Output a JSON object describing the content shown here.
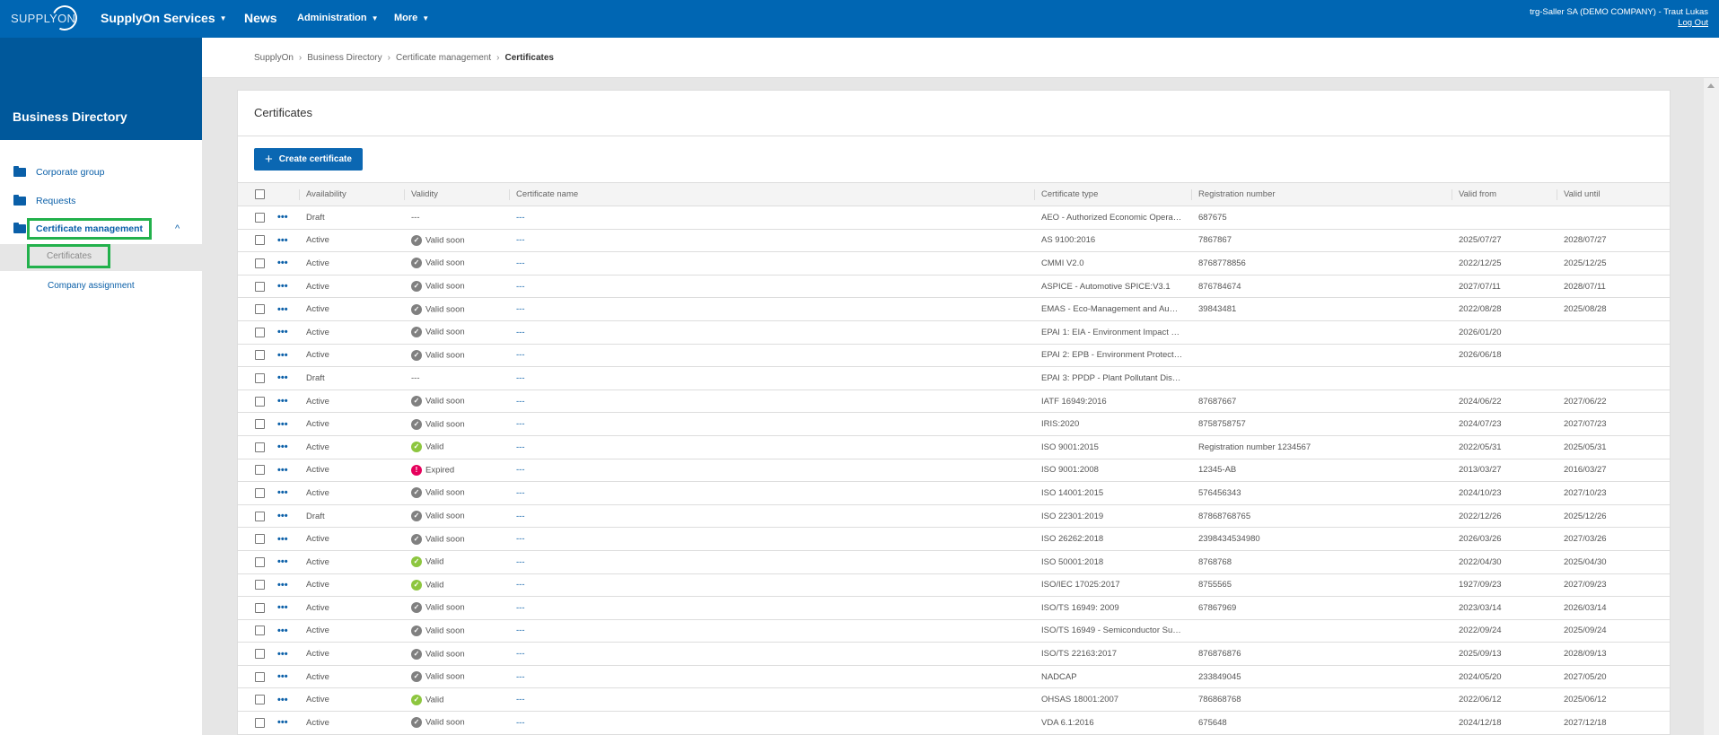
{
  "topbar": {
    "logo": "SUPPLYON",
    "services": "SupplyOn Services",
    "news": "News",
    "administration": "Administration",
    "more": "More",
    "user": "trg-Saller SA (DEMO COMPANY) - Traut Lukas",
    "logout": "Log Out",
    "caret": "▼"
  },
  "sidebar": {
    "title": "Business Directory",
    "items": [
      {
        "label": "Corporate group"
      },
      {
        "label": "Requests"
      },
      {
        "label": "Certificate management"
      }
    ],
    "chevron": "^",
    "sub_items": [
      {
        "label": "Certificates"
      },
      {
        "label": "Company assignment"
      }
    ]
  },
  "breadcrumb": {
    "items": [
      "SupplyOn",
      "Business Directory",
      "Certificate management"
    ],
    "current": "Certificates",
    "sep": "›"
  },
  "card": {
    "title": "Certificates",
    "create_button": "Create certificate",
    "plus": "+"
  },
  "table": {
    "columns": [
      "Availability",
      "Validity",
      "Certificate name",
      "Certificate type",
      "Registration number",
      "Valid from",
      "Valid until"
    ],
    "rows": [
      {
        "availability": "Draft",
        "validity": "---",
        "status": "none",
        "name": "---",
        "type": "AEO - Authorized Economic Opera…",
        "reg": "687675",
        "from": "",
        "until": ""
      },
      {
        "availability": "Active",
        "validity": "Valid soon",
        "status": "soon",
        "name": "---",
        "type": "AS 9100:2016",
        "reg": "7867867",
        "from": "2025/07/27",
        "until": "2028/07/27"
      },
      {
        "availability": "Active",
        "validity": "Valid soon",
        "status": "soon",
        "name": "---",
        "type": "CMMI V2.0",
        "reg": "8768778856",
        "from": "2022/12/25",
        "until": "2025/12/25"
      },
      {
        "availability": "Active",
        "validity": "Valid soon",
        "status": "soon",
        "name": "---",
        "type": "ASPICE - Automotive SPICE:V3.1",
        "reg": "876784674",
        "from": "2027/07/11",
        "until": "2028/07/11"
      },
      {
        "availability": "Active",
        "validity": "Valid soon",
        "status": "soon",
        "name": "---",
        "type": "EMAS - Eco-Management and Au…",
        "reg": "39843481",
        "from": "2022/08/28",
        "until": "2025/08/28"
      },
      {
        "availability": "Active",
        "validity": "Valid soon",
        "status": "soon",
        "name": "---",
        "type": "EPAI 1: EIA - Environment Impact …",
        "reg": "",
        "from": "2026/01/20",
        "until": ""
      },
      {
        "availability": "Active",
        "validity": "Valid soon",
        "status": "soon",
        "name": "---",
        "type": "EPAI 2: EPB - Environment Protect…",
        "reg": "",
        "from": "2026/06/18",
        "until": ""
      },
      {
        "availability": "Draft",
        "validity": "---",
        "status": "none",
        "name": "---",
        "type": "EPAI 3: PPDP - Plant Pollutant Dis…",
        "reg": "",
        "from": "",
        "until": ""
      },
      {
        "availability": "Active",
        "validity": "Valid soon",
        "status": "soon",
        "name": "---",
        "type": "IATF 16949:2016",
        "reg": "87687667",
        "from": "2024/06/22",
        "until": "2027/06/22"
      },
      {
        "availability": "Active",
        "validity": "Valid soon",
        "status": "soon",
        "name": "---",
        "type": "IRIS:2020",
        "reg": "8758758757",
        "from": "2024/07/23",
        "until": "2027/07/23"
      },
      {
        "availability": "Active",
        "validity": "Valid",
        "status": "valid",
        "name": "---",
        "type": "ISO 9001:2015",
        "reg": "Registration number 1234567",
        "from": "2022/05/31",
        "until": "2025/05/31"
      },
      {
        "availability": "Active",
        "validity": "Expired",
        "status": "expired",
        "name": "---",
        "type": "ISO 9001:2008",
        "reg": "12345-AB",
        "from": "2013/03/27",
        "until": "2016/03/27"
      },
      {
        "availability": "Active",
        "validity": "Valid soon",
        "status": "soon",
        "name": "---",
        "type": "ISO 14001:2015",
        "reg": "576456343",
        "from": "2024/10/23",
        "until": "2027/10/23"
      },
      {
        "availability": "Draft",
        "validity": "Valid soon",
        "status": "soon",
        "name": "---",
        "type": "ISO 22301:2019",
        "reg": "87868768765",
        "from": "2022/12/26",
        "until": "2025/12/26"
      },
      {
        "availability": "Active",
        "validity": "Valid soon",
        "status": "soon",
        "name": "---",
        "type": "ISO 26262:2018",
        "reg": "2398434534980",
        "from": "2026/03/26",
        "until": "2027/03/26"
      },
      {
        "availability": "Active",
        "validity": "Valid",
        "status": "valid",
        "name": "---",
        "type": "ISO 50001:2018",
        "reg": "8768768",
        "from": "2022/04/30",
        "until": "2025/04/30"
      },
      {
        "availability": "Active",
        "validity": "Valid",
        "status": "valid",
        "name": "---",
        "type": "ISO/IEC 17025:2017",
        "reg": "8755565",
        "from": "1927/09/23",
        "until": "2027/09/23"
      },
      {
        "availability": "Active",
        "validity": "Valid soon",
        "status": "soon",
        "name": "---",
        "type": "ISO/TS 16949: 2009",
        "reg": "67867969",
        "from": "2023/03/14",
        "until": "2026/03/14"
      },
      {
        "availability": "Active",
        "validity": "Valid soon",
        "status": "soon",
        "name": "---",
        "type": "ISO/TS 16949 - Semiconductor Su…",
        "reg": "",
        "from": "2022/09/24",
        "until": "2025/09/24"
      },
      {
        "availability": "Active",
        "validity": "Valid soon",
        "status": "soon",
        "name": "---",
        "type": "ISO/TS 22163:2017",
        "reg": "876876876",
        "from": "2025/09/13",
        "until": "2028/09/13"
      },
      {
        "availability": "Active",
        "validity": "Valid soon",
        "status": "soon",
        "name": "---",
        "type": "NADCAP",
        "reg": "233849045",
        "from": "2024/05/20",
        "until": "2027/05/20"
      },
      {
        "availability": "Active",
        "validity": "Valid",
        "status": "valid",
        "name": "---",
        "type": "OHSAS 18001:2007",
        "reg": "786868768",
        "from": "2022/06/12",
        "until": "2025/06/12"
      },
      {
        "availability": "Active",
        "validity": "Valid soon",
        "status": "soon",
        "name": "---",
        "type": "VDA 6.1:2016",
        "reg": "675648",
        "from": "2024/12/18",
        "until": "2027/12/18"
      }
    ]
  },
  "icons": {
    "dots": "•••",
    "check": "✓",
    "exclaim": "!"
  }
}
